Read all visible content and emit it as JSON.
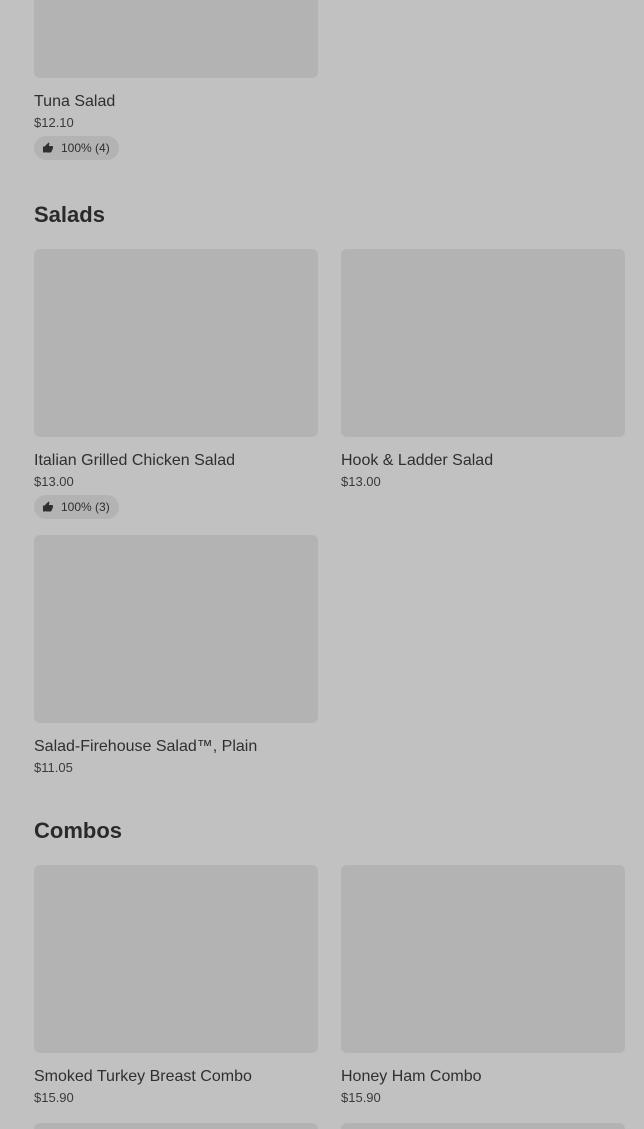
{
  "sections": {
    "salads": {
      "title": "Salads"
    },
    "combos": {
      "title": "Combos"
    }
  },
  "items": {
    "tuna_salad": {
      "name": "Tuna Salad",
      "price": "$12.10",
      "rating": "100% (4)"
    },
    "italian_grilled_chicken_salad": {
      "name": "Italian Grilled Chicken Salad",
      "price": "$13.00",
      "rating": "100% (3)"
    },
    "hook_ladder_salad": {
      "name": "Hook & Ladder Salad",
      "price": "$13.00"
    },
    "firehouse_salad_plain": {
      "name": "Salad-Firehouse Salad™, Plain",
      "price": "$11.05"
    },
    "smoked_turkey_breast_combo": {
      "name": "Smoked Turkey Breast Combo",
      "price": "$15.90"
    },
    "honey_ham_combo": {
      "name": "Honey Ham Combo",
      "price": "$15.90"
    }
  },
  "icons": {
    "rating": "thumbs-up-icon"
  },
  "colors": {
    "background": "#c1c1c1",
    "placeholder": "#b3b3b3"
  }
}
